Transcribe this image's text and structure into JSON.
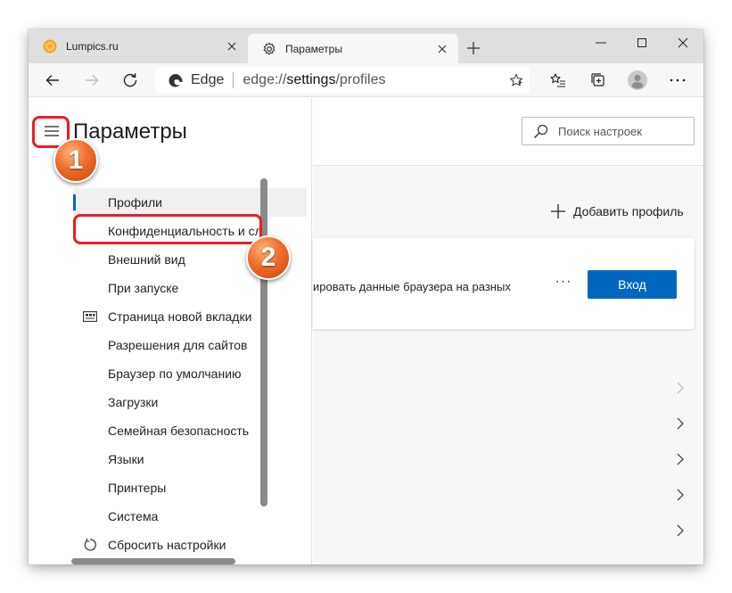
{
  "tabs": [
    {
      "label": "Lumpics.ru",
      "icon": "orange-slice-icon",
      "active": false
    },
    {
      "label": "Параметры",
      "icon": "gear-icon",
      "active": true
    }
  ],
  "toolbar": {
    "site_name": "Edge",
    "url_prefix": "edge://",
    "url_bold": "settings",
    "url_suffix": "/profiles"
  },
  "sidebar": {
    "title": "Параметры",
    "items": [
      {
        "label": "Профили",
        "icon": ""
      },
      {
        "label": "Конфиденциальность и сл",
        "icon": ""
      },
      {
        "label": "Внешний вид",
        "icon": ""
      },
      {
        "label": "При запуске",
        "icon": ""
      },
      {
        "label": "Страница новой вкладки",
        "icon": "new-tab-page-icon"
      },
      {
        "label": "Разрешения для сайтов",
        "icon": ""
      },
      {
        "label": "Браузер по умолчанию",
        "icon": ""
      },
      {
        "label": "Загрузки",
        "icon": ""
      },
      {
        "label": "Семейная безопасность",
        "icon": ""
      },
      {
        "label": "Языки",
        "icon": ""
      },
      {
        "label": "Принтеры",
        "icon": ""
      },
      {
        "label": "Система",
        "icon": ""
      },
      {
        "label": "Сбросить настройки",
        "icon": "reset-icon"
      }
    ]
  },
  "main": {
    "search_placeholder": "Поиск настроек",
    "add_profile_label": "Добавить профиль",
    "card_text": "ировать данные браузера на разных",
    "more_label": "···",
    "login_label": "Вход"
  },
  "annotations": {
    "badge1": "1",
    "badge2": "2",
    "color": "#ee1c24"
  },
  "colors": {
    "accent": "#0067c0",
    "badge": "#f06d2a"
  }
}
